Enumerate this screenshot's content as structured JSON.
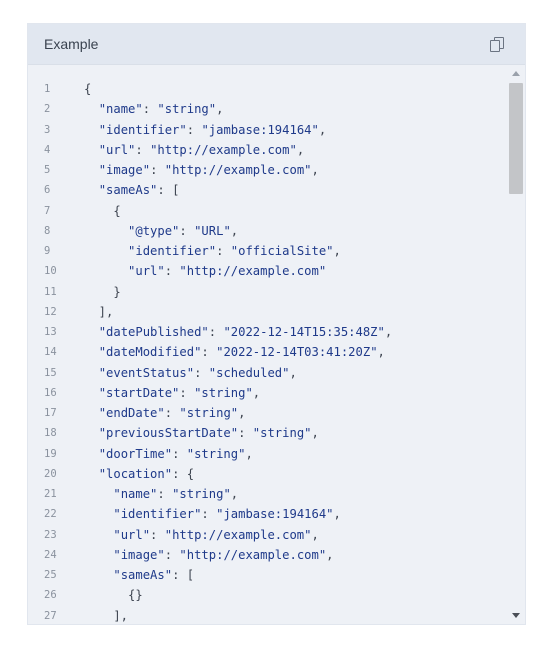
{
  "panel": {
    "title": "Example",
    "copy_icon": "copy-icon"
  },
  "code_lines": [
    [
      [
        "p",
        "{"
      ]
    ],
    [
      [
        "p",
        "  "
      ],
      [
        "k",
        "\"name\""
      ],
      [
        "p",
        ": "
      ],
      [
        "s",
        "\"string\""
      ],
      [
        "p",
        ","
      ]
    ],
    [
      [
        "p",
        "  "
      ],
      [
        "k",
        "\"identifier\""
      ],
      [
        "p",
        ": "
      ],
      [
        "s",
        "\"jambase:194164\""
      ],
      [
        "p",
        ","
      ]
    ],
    [
      [
        "p",
        "  "
      ],
      [
        "k",
        "\"url\""
      ],
      [
        "p",
        ": "
      ],
      [
        "s",
        "\"http://example.com\""
      ],
      [
        "p",
        ","
      ]
    ],
    [
      [
        "p",
        "  "
      ],
      [
        "k",
        "\"image\""
      ],
      [
        "p",
        ": "
      ],
      [
        "s",
        "\"http://example.com\""
      ],
      [
        "p",
        ","
      ]
    ],
    [
      [
        "p",
        "  "
      ],
      [
        "k",
        "\"sameAs\""
      ],
      [
        "p",
        ": ["
      ]
    ],
    [
      [
        "p",
        "    {"
      ]
    ],
    [
      [
        "p",
        "      "
      ],
      [
        "k",
        "\"@type\""
      ],
      [
        "p",
        ": "
      ],
      [
        "s",
        "\"URL\""
      ],
      [
        "p",
        ","
      ]
    ],
    [
      [
        "p",
        "      "
      ],
      [
        "k",
        "\"identifier\""
      ],
      [
        "p",
        ": "
      ],
      [
        "s",
        "\"officialSite\""
      ],
      [
        "p",
        ","
      ]
    ],
    [
      [
        "p",
        "      "
      ],
      [
        "k",
        "\"url\""
      ],
      [
        "p",
        ": "
      ],
      [
        "s",
        "\"http://example.com\""
      ]
    ],
    [
      [
        "p",
        "    }"
      ]
    ],
    [
      [
        "p",
        "  ],"
      ]
    ],
    [
      [
        "p",
        "  "
      ],
      [
        "k",
        "\"datePublished\""
      ],
      [
        "p",
        ": "
      ],
      [
        "s",
        "\"2022-12-14T15:35:48Z\""
      ],
      [
        "p",
        ","
      ]
    ],
    [
      [
        "p",
        "  "
      ],
      [
        "k",
        "\"dateModified\""
      ],
      [
        "p",
        ": "
      ],
      [
        "s",
        "\"2022-12-14T03:41:20Z\""
      ],
      [
        "p",
        ","
      ]
    ],
    [
      [
        "p",
        "  "
      ],
      [
        "k",
        "\"eventStatus\""
      ],
      [
        "p",
        ": "
      ],
      [
        "s",
        "\"scheduled\""
      ],
      [
        "p",
        ","
      ]
    ],
    [
      [
        "p",
        "  "
      ],
      [
        "k",
        "\"startDate\""
      ],
      [
        "p",
        ": "
      ],
      [
        "s",
        "\"string\""
      ],
      [
        "p",
        ","
      ]
    ],
    [
      [
        "p",
        "  "
      ],
      [
        "k",
        "\"endDate\""
      ],
      [
        "p",
        ": "
      ],
      [
        "s",
        "\"string\""
      ],
      [
        "p",
        ","
      ]
    ],
    [
      [
        "p",
        "  "
      ],
      [
        "k",
        "\"previousStartDate\""
      ],
      [
        "p",
        ": "
      ],
      [
        "s",
        "\"string\""
      ],
      [
        "p",
        ","
      ]
    ],
    [
      [
        "p",
        "  "
      ],
      [
        "k",
        "\"doorTime\""
      ],
      [
        "p",
        ": "
      ],
      [
        "s",
        "\"string\""
      ],
      [
        "p",
        ","
      ]
    ],
    [
      [
        "p",
        "  "
      ],
      [
        "k",
        "\"location\""
      ],
      [
        "p",
        ": {"
      ]
    ],
    [
      [
        "p",
        "    "
      ],
      [
        "k",
        "\"name\""
      ],
      [
        "p",
        ": "
      ],
      [
        "s",
        "\"string\""
      ],
      [
        "p",
        ","
      ]
    ],
    [
      [
        "p",
        "    "
      ],
      [
        "k",
        "\"identifier\""
      ],
      [
        "p",
        ": "
      ],
      [
        "s",
        "\"jambase:194164\""
      ],
      [
        "p",
        ","
      ]
    ],
    [
      [
        "p",
        "    "
      ],
      [
        "k",
        "\"url\""
      ],
      [
        "p",
        ": "
      ],
      [
        "s",
        "\"http://example.com\""
      ],
      [
        "p",
        ","
      ]
    ],
    [
      [
        "p",
        "    "
      ],
      [
        "k",
        "\"image\""
      ],
      [
        "p",
        ": "
      ],
      [
        "s",
        "\"http://example.com\""
      ],
      [
        "p",
        ","
      ]
    ],
    [
      [
        "p",
        "    "
      ],
      [
        "k",
        "\"sameAs\""
      ],
      [
        "p",
        ": ["
      ]
    ],
    [
      [
        "p",
        "      {}"
      ]
    ],
    [
      [
        "p",
        "    ],"
      ]
    ]
  ],
  "scrollbar": {
    "position": 0.0
  }
}
